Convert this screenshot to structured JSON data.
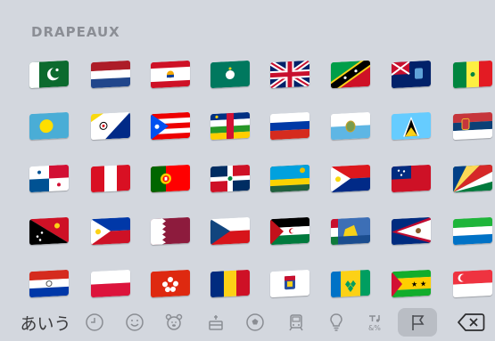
{
  "keyboard": {
    "section_title": "DRAPEAUX",
    "flags_grid": [
      [
        "Pakistan",
        "Netherlands",
        "French Polynesia",
        "Macau",
        "United Kingdom",
        "St Kitts & Nevis",
        "St Helena",
        "Senegal"
      ],
      [
        "Palau",
        "Bonaire",
        "Puerto Rico",
        "Central African Republic",
        "Russia",
        "San Marino",
        "St Lucia",
        "Serbia"
      ],
      [
        "Panama",
        "Peru",
        "Portugal",
        "Dominican Republic",
        "Rwanda",
        "Sint Maarten",
        "Samoa",
        "Seychelles"
      ],
      [
        "Papua New Guinea",
        "Philippines",
        "Qatar",
        "Czechia",
        "Western Sahara",
        "St Pierre & Miquelon",
        "American Samoa",
        "Sierra Leone"
      ],
      [
        "Paraguay",
        "Poland",
        "Hong Kong",
        "Romania",
        "St Barthelemy",
        "St Vincent & Grenadines",
        "Sao Tome & Principe",
        "Singapore"
      ]
    ],
    "bottom_bar": {
      "kana_label": "あいう",
      "categories": [
        "recent-icon",
        "smileys-icon",
        "animals-icon",
        "food-icon",
        "activity-icon",
        "travel-icon",
        "objects-icon",
        "symbols-icon",
        "flags-icon"
      ],
      "active_category": "flags-icon",
      "delete": "delete-icon"
    }
  }
}
